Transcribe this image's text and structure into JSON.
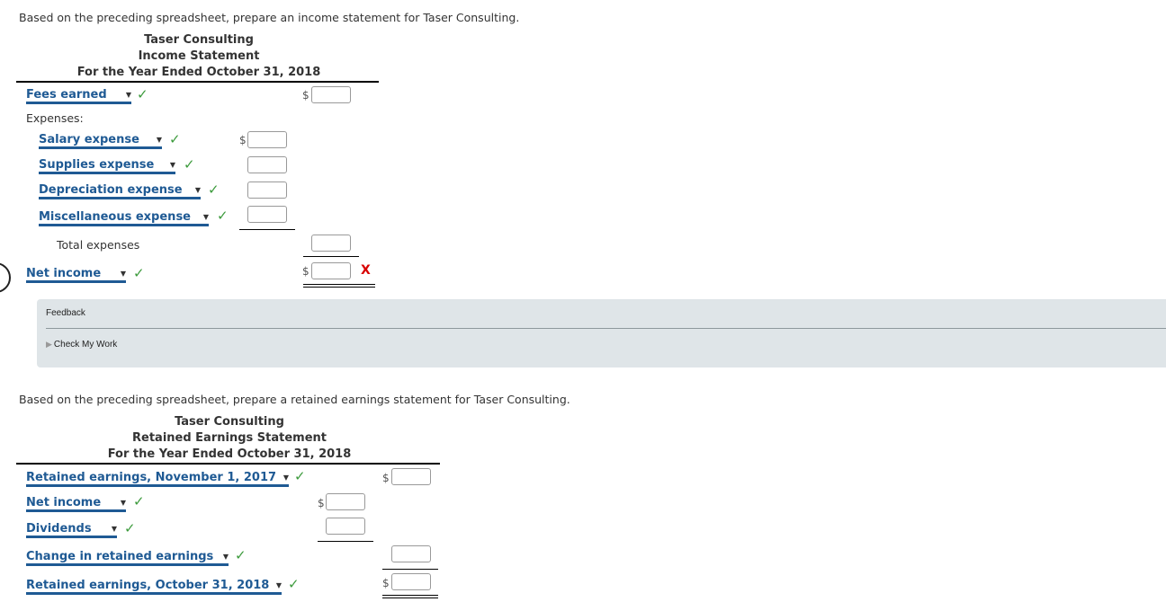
{
  "income_statement": {
    "prompt": "Based on the preceding spreadsheet, prepare an income statement for Taser Consulting.",
    "company": "Taser Consulting",
    "title": "Income Statement",
    "period": "For the Year Ended October 31, 2018",
    "fees_earned": {
      "label": "Fees earned",
      "value": "",
      "status": "correct"
    },
    "expenses_label": "Expenses:",
    "expenses": [
      {
        "label": "Salary expense",
        "value": "",
        "status": "correct"
      },
      {
        "label": "Supplies expense",
        "value": "",
        "status": "correct"
      },
      {
        "label": "Depreciation expense",
        "value": "",
        "status": "correct"
      },
      {
        "label": "Miscellaneous expense",
        "value": "",
        "status": "correct"
      }
    ],
    "total_expenses_label": "Total expenses",
    "total_expenses_value": "",
    "net_income": {
      "label": "Net income",
      "value": "",
      "status": "correct",
      "value_status": "incorrect"
    },
    "currency_symbol": "$"
  },
  "feedback": {
    "title": "Feedback",
    "check_my_work": "Check My Work"
  },
  "retained_earnings_statement": {
    "prompt": "Based on the preceding spreadsheet, prepare a retained earnings statement for Taser Consulting.",
    "company": "Taser Consulting",
    "title": "Retained Earnings Statement",
    "period": "For the Year Ended October 31, 2018",
    "beginning": {
      "label": "Retained earnings, November 1, 2017",
      "value": "",
      "status": "correct"
    },
    "net_income": {
      "label": "Net income",
      "value": "",
      "status": "correct"
    },
    "dividends": {
      "label": "Dividends",
      "value": "",
      "status": "correct"
    },
    "change": {
      "label": "Change in retained earnings",
      "value": "",
      "status": "correct"
    },
    "ending": {
      "label": "Retained earnings, October 31, 2018",
      "value": "",
      "status": "correct"
    },
    "currency_symbol": "$"
  },
  "marks": {
    "correct": "✓",
    "incorrect": "X"
  }
}
